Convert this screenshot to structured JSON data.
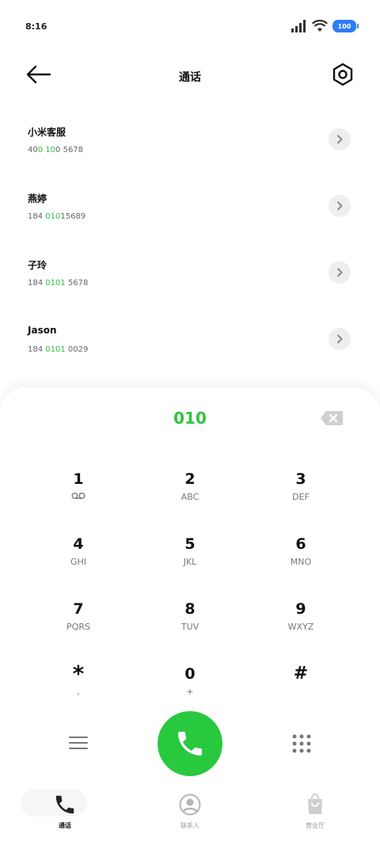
{
  "status_bar": {
    "time": "8:16",
    "battery": "100",
    "battery_color": "#2e7cf6"
  },
  "header": {
    "title": "通话",
    "back_icon": "arrow-left-icon",
    "settings_icon": "hexagon-settings-icon"
  },
  "contacts": [
    {
      "name": "小米客服",
      "number_parts": [
        "40",
        "0",
        " ",
        "10",
        "0",
        " 5678"
      ],
      "highlight": [
        false,
        true,
        false,
        true,
        false,
        false
      ]
    },
    {
      "name": "燕婷",
      "number_parts": [
        "184 ",
        "010",
        "15689"
      ],
      "highlight": [
        false,
        true,
        false
      ]
    },
    {
      "name": "子玲",
      "number_parts": [
        "184 ",
        "0101",
        " 5678"
      ],
      "highlight": [
        false,
        true,
        false
      ]
    },
    {
      "name": "Jason",
      "number_parts": [
        "184 ",
        "0101",
        " 0029"
      ],
      "highlight": [
        false,
        true,
        false
      ]
    }
  ],
  "dialer": {
    "input_value": "010",
    "accent_color": "#2ec440",
    "keys": [
      {
        "digit": "1",
        "letters": "",
        "sub_icon": "voicemail-icon"
      },
      {
        "digit": "2",
        "letters": "ABC"
      },
      {
        "digit": "3",
        "letters": "DEF"
      },
      {
        "digit": "4",
        "letters": "GHI"
      },
      {
        "digit": "5",
        "letters": "JKL"
      },
      {
        "digit": "6",
        "letters": "MNO"
      },
      {
        "digit": "7",
        "letters": "PQRS"
      },
      {
        "digit": "8",
        "letters": "TUV"
      },
      {
        "digit": "9",
        "letters": "WXYZ"
      },
      {
        "digit": "*",
        "letters": ","
      },
      {
        "digit": "0",
        "letters": "+"
      },
      {
        "digit": "#",
        "letters": ""
      }
    ],
    "call_color": "#28c83f"
  },
  "bottom_nav": [
    {
      "label": "通话",
      "icon": "phone-icon",
      "active": true
    },
    {
      "label": "联系人",
      "icon": "contact-person-icon",
      "active": false
    },
    {
      "label": "营业厅",
      "icon": "shopping-bag-icon",
      "active": false
    }
  ]
}
